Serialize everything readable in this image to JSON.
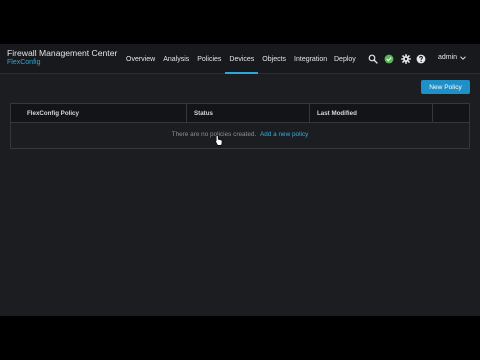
{
  "header": {
    "app_title": "Firewall Management Center",
    "app_subtitle": "FlexConfig"
  },
  "nav": {
    "items": [
      {
        "label": "Overview",
        "active": false
      },
      {
        "label": "Analysis",
        "active": false
      },
      {
        "label": "Policies",
        "active": false
      },
      {
        "label": "Devices",
        "active": true
      },
      {
        "label": "Objects",
        "active": false
      },
      {
        "label": "Integration",
        "active": false
      }
    ],
    "deploy_label": "Deploy"
  },
  "icons": {
    "search": "search-icon",
    "status": "status-check-icon",
    "settings": "gear-icon",
    "help": "help-icon",
    "user_menu": "chevron-down-icon"
  },
  "user": {
    "name": "admin"
  },
  "toolbar": {
    "new_policy_label": "New Policy"
  },
  "table": {
    "columns": [
      "FlexConfig Policy",
      "Status",
      "Last Modified",
      ""
    ],
    "empty_text": "There are no policies created.",
    "empty_link": "Add a new policy"
  },
  "colors": {
    "accent": "#1e8fc7",
    "link": "#35aee6",
    "status_ok": "#5cb85c",
    "background": "#1b1d21"
  }
}
